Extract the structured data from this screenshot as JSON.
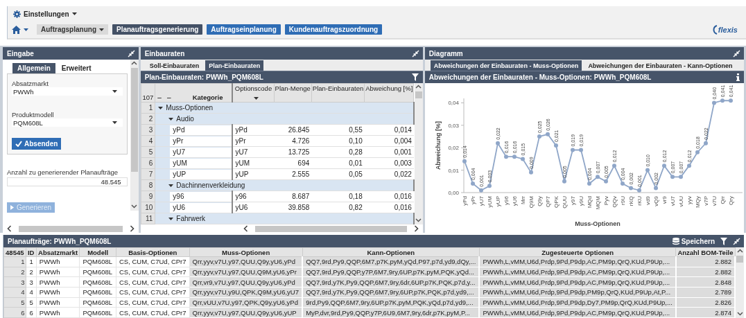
{
  "settings_menu": {
    "label": "Einstellungen"
  },
  "nav": {
    "items": [
      {
        "label": "Auftragsplanung",
        "kind": "dropdown",
        "selected": false
      },
      {
        "label": "Planauftragsgenerierung",
        "kind": "link",
        "selected": true
      },
      {
        "label": "Auftragseinplanung",
        "kind": "link",
        "selected": false
      },
      {
        "label": "Kundenauftragszuordnung",
        "kind": "link",
        "selected": false
      }
    ]
  },
  "logo": {
    "text": "flexis"
  },
  "input_panel": {
    "title": "Eingabe",
    "tabs": [
      {
        "label": "Allgemein",
        "selected": true
      },
      {
        "label": "Erweitert",
        "selected": false
      }
    ],
    "fields": [
      {
        "label": "Absatzmarkt",
        "value": "PWWh"
      },
      {
        "label": "Produktmodell",
        "value": "PQM608L"
      }
    ],
    "submit_button": "Absenden",
    "count_label": "Anzahl zu generierender Planaufträge",
    "count_value": "48.545",
    "generate_button": {
      "label": "Generieren",
      "disabled": true
    }
  },
  "rates_panel": {
    "title": "Einbauraten",
    "tabs": [
      {
        "label": "Soll-Einbauraten",
        "selected": false
      },
      {
        "label": "Plan-Einbauraten",
        "selected": true
      }
    ],
    "table_title": "Plan-Einbauraten: PWWh_PQM608L",
    "row_count": "107",
    "level_buttons": [
      "–",
      "–"
    ],
    "columns": [
      "Kategorie",
      "Optionscode",
      "Plan-Menge",
      "Plan-Einbauraten",
      "Abweichung [%]"
    ],
    "rows": [
      {
        "kind": "group",
        "row_number": "1",
        "label": "Muss-Optionen",
        "expanded": true,
        "children": [
          {
            "kind": "group",
            "row_number": "2",
            "label": "Audio",
            "expanded": true,
            "children": [
              {
                "kind": "option",
                "row_number": "3",
                "label": "yPd",
                "values": [
                  "yPd",
                  "26.845",
                  "0,55",
                  "0,014"
                ]
              },
              {
                "kind": "option",
                "row_number": "4",
                "label": "yPr",
                "values": [
                  "yPr",
                  "4.726",
                  "0,10",
                  "0,004"
                ]
              },
              {
                "kind": "option",
                "row_number": "5",
                "label": "yU7",
                "values": [
                  "yU7",
                  "13.725",
                  "0,28",
                  "0,001"
                ]
              },
              {
                "kind": "option",
                "row_number": "6",
                "label": "yUM",
                "values": [
                  "yUM",
                  "694",
                  "0,01",
                  "0,003"
                ]
              },
              {
                "kind": "option",
                "row_number": "7",
                "label": "yUP",
                "values": [
                  "yUP",
                  "2.555",
                  "0,05",
                  "0,022"
                ]
              }
            ]
          },
          {
            "kind": "group",
            "row_number": "8",
            "label": "Dachinnenverkleidung",
            "expanded": true,
            "children": [
              {
                "kind": "option",
                "row_number": "9",
                "label": "y96",
                "values": [
                  "y96",
                  "8.687",
                  "0,18",
                  "0,016"
                ]
              },
              {
                "kind": "option",
                "row_number": "10",
                "label": "yU6",
                "values": [
                  "yU6",
                  "39.858",
                  "0,82",
                  "0,016"
                ]
              }
            ]
          },
          {
            "kind": "group",
            "row_number": "11",
            "label": "Fahrwerk",
            "expanded": true
          }
        ]
      }
    ]
  },
  "chart_panel": {
    "title": "Diagramm",
    "tabs": [
      {
        "label": "Abweichungen der Einbauraten - Muss-Optionen",
        "selected": true
      },
      {
        "label": "Abweichungen der Einbauraten - Kann-Optionen",
        "selected": false
      }
    ],
    "chart_title": "Abweichungen der Einbauraten - Muss-Optionen: PWWh_PQM608L",
    "chart_data": {
      "type": "line",
      "xlabel": "Muss-Optionen",
      "ylabel": "Abweichung [%]",
      "categories": [
        "yPd",
        "yPr",
        "yU7",
        "yUM",
        "yUP",
        "y96",
        "yU6",
        "Mrr",
        "Q9M",
        "Q9y",
        "QP7",
        "QPK",
        "QUU",
        "y97",
        "y9U",
        "MQd",
        "MQM",
        "Pyv",
        "QQv",
        "r9U",
        "rKQ",
        "rKU",
        "vd9",
        "vQ9",
        "vr9",
        "vU7",
        "vUU",
        "yyv",
        "MQy",
        "v7P",
        "v7U",
        "Qrr",
        "Qry"
      ],
      "series": [
        {
          "color": "#8fa6c8",
          "marker": "circle",
          "values": [
            0.014,
            0.004,
            0.001,
            0.003,
            0.022,
            0.016,
            0.016,
            0.015,
            0.009,
            0.025,
            0.026,
            0.021,
            0.005,
            0.019,
            0.019,
            0.004,
            0.007,
            0.005,
            0.012,
            0.004,
            0.002,
            0.001,
            0.01,
            0.002,
            0.012,
            0.007,
            0.007,
            0.012,
            0.018,
            0.022,
            0.04,
            0.041,
            0.041
          ]
        }
      ],
      "ylim": [
        0,
        0.042
      ],
      "yticks": [
        {
          "value": 0,
          "label": "0,00"
        },
        {
          "value": 0.01,
          "label": "0,01"
        },
        {
          "value": 0.02,
          "label": "0,02"
        },
        {
          "value": 0.03,
          "label": "0,03"
        },
        {
          "value": 0.04,
          "label": "0,04"
        }
      ],
      "value_labels": [
        "0,014",
        "0,004",
        "0,001",
        "0,003",
        "0,022",
        "0,016",
        "0,016",
        "0,015",
        "0,009",
        "0,025",
        "0,026",
        "0,021",
        "0,005",
        "0,019",
        "0,019",
        "0,004",
        "0,007",
        "0,005",
        "0,012",
        "0,004",
        "0,002",
        "0,001",
        "0,010",
        "0,002",
        "0,012",
        "0,007",
        "0,007",
        "0,012",
        "0,018",
        "0,022",
        "0,040",
        "0,041",
        "0,041"
      ]
    }
  },
  "orders_panel": {
    "title": "Planaufträge: PWWh_PQM608L",
    "save_button": "Speichern",
    "row_count": "48545",
    "columns": [
      "ID",
      "Absatzmarkt",
      "Modell",
      "Basis-Optionen",
      "Muss-Optionen",
      "Kann-Optionen",
      "Zugesteuerte Optionen",
      "Anzahl BOM-Teile"
    ],
    "rows": [
      {
        "row_number": "1",
        "cells": [
          "1",
          "PWWh",
          "PQM608L",
          "CS, CUM, C7Ud, CPr7",
          "Qrr,yyv,v7U,y97,QUU,Q9y,yU6,yPd",
          "QQ7,9rd,Py9,QQP,6M7,p7K,pyM,yQd,P97,p7d,yd9,dQy,...",
          "PWWh,L,vMM,U6d,Prdp,9Pd,P9dp,AC,PM9p,QrQ,KUd,P9Up,...",
          "2.882"
        ]
      },
      {
        "row_number": "2",
        "cells": [
          "2",
          "PWWh",
          "PQM608L",
          "CS, CUM, C7Ud, CPr7",
          "Qrr,yyv,v7U,y97,QUU,Q9M,yU6,yPr",
          "QQ7,9rd,Py9,QQP,y7P,6M7,9ry,6UP,p7K,pyM,PQK,yQd...",
          "PWWh,L,vMM,U6d,Prdp,9Pd,P9dp,AC,PM9p,QrQ,KUd,P9Up,...",
          "2.882"
        ]
      },
      {
        "row_number": "3",
        "cells": [
          "3",
          "PWWh",
          "PQM608L",
          "CS, CUM, C7Ud, CPr7",
          "Qrr,vr9,v7U,y97,QUU,Q9y,yU6,yPd",
          "QQ7,9rd,y7K,Py9,QQP,6M7,9ry,6dr,6UP,p7K,PQK,p7d,y...",
          "PWWh,L,vMM,U6d,Prdp,9Pd,P9dp,AC,PM9p,QrQ,KUd,P9Up,...",
          "2.848"
        ]
      },
      {
        "row_number": "4",
        "cells": [
          "4",
          "PWWh",
          "PQM608L",
          "CS, CUM, C7Ud, CPr7",
          "Qrr,yyv,v7U,y9U,QPK,Q9M,yU6,yU7",
          "QQ7,9rd,y7K,Py9,QQP,6M7,9ry,6UP,p7K,PQK,p7d,yd9,...",
          "PWWh,L,vMM,U6d,Prdp,9Pd,P9dp,PM9p,QrQ,KUd,P9Up,At,P...",
          "2.789"
        ]
      },
      {
        "row_number": "5",
        "cells": [
          "5",
          "PWWh",
          "PQM608L",
          "CS, CUM, C7Ud, CPr7",
          "Qrr,vUU,v7U,y97,QPK,Q9y,yU6,yPd",
          "9rd,Py9,QQP,6M7,9ry,6UP,p7K,pyM,PQK,yQd,p7d,yd9,...",
          "PWWh,L,vMM,U6d,Prdp,9Pd,P9dp,Dy7,PM9p,QrQ,KUd,P9Up,...",
          "2.826"
        ]
      },
      {
        "row_number": "6",
        "cells": [
          "6",
          "PWWh",
          "PQM608L",
          "CS, CUM, C7Ud, CPr7",
          "Qrr,yyv,v7U,y97,QUU,Q9y,yU6,yUP",
          "MyP,dvr,9rd,Py9,QQP,y7P,6U9,6M7,9ry,6dr,p7K,pyM,P...",
          "PWWh,L,vMM,U6d,Prdp,9Pd,P9dp,AC,PM9p,QrQ,KUd,P9Up,...",
          "2.874"
        ]
      }
    ]
  }
}
